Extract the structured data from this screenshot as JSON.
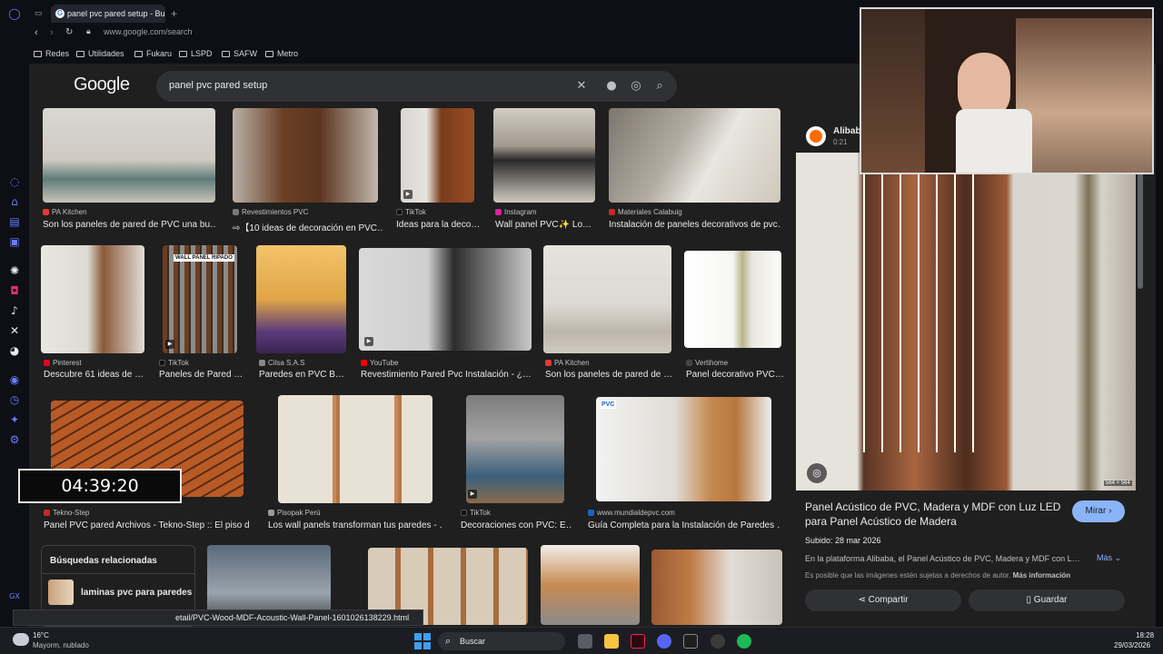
{
  "browser": {
    "tab_title": "panel pvc pared setup - Bu",
    "url": "www.google.com/search",
    "bookmarks": [
      "Redes",
      "Utilidades",
      "Fukaru",
      "LSPD",
      "SAFW",
      "Metro"
    ]
  },
  "search": {
    "logo": "Google",
    "query": "panel pvc pared setup"
  },
  "results": [
    {
      "source": "PA Kitchen",
      "title": "Son los paneles de pared de PVC una bu…",
      "fav": "#e53935"
    },
    {
      "source": "Revestimientos PVC",
      "title": "⇨【10 ideas de decoración en PVC…",
      "fav": "#777777"
    },
    {
      "source": "TikTok",
      "title": "Ideas para la deco…",
      "fav": "#111111"
    },
    {
      "source": "Instagram",
      "title": "Wall panel PVC✨ Lo…",
      "fav": "#d6249f"
    },
    {
      "source": "Materiales Calabuig",
      "title": "Instalación de paneles decorativos de pvc…",
      "fav": "#c62828"
    },
    {
      "source": "Pinterest",
      "title": "Descubre 61 ideas de …",
      "fav": "#e60023"
    },
    {
      "source": "TikTok",
      "title": "Paneles de Pared …",
      "fav": "#111111"
    },
    {
      "source": "Cilsa S.A.S",
      "title": "Paredes en PVC B…",
      "fav": "#888888"
    },
    {
      "source": "YouTube",
      "title": "Revestimiento Pared Pvc Instalación - ¿…",
      "fav": "#ff0000"
    },
    {
      "source": "PA Kitchen",
      "title": "Son los paneles de pared de …",
      "fav": "#e53935"
    },
    {
      "source": "Vertihome",
      "title": "Panel decorativo PVC…",
      "fav": "#444444"
    },
    {
      "source": "Tekno-Step",
      "title": "Panel PVC pared Archivos - Tekno-Step :: El piso d…",
      "fav": "#c62828"
    },
    {
      "source": "Pisopak Perú",
      "title": "Los wall panels transforman tus paredes - …",
      "fav": "#999999"
    },
    {
      "source": "TikTok",
      "title": "Decoraciones con PVC: E…",
      "fav": "#111111"
    },
    {
      "source": "www.mundialdepvc.com",
      "title": "Guía Completa para la Instalación de Paredes …",
      "fav": "#1565c0"
    }
  ],
  "thumb_badge": "WALL PANEL RIPADO",
  "thumb_logo": "PVC",
  "related": {
    "heading": "Búsquedas relacionadas",
    "item": "laminas pvc para paredes"
  },
  "panel": {
    "site": "Alibab",
    "time": "0:21",
    "dims": "564 × 564",
    "title": "Panel Acústico de PVC, Madera y MDF con Luz LED para Panel Acústico de Madera",
    "date": "Subido: 28 mar 2026",
    "desc": "En la plataforma Alibaba, el Panel Acústico de PVC, Madera y MDF con L…",
    "more": "Más",
    "copyright": "Es posible que las imágenes estén sujetas a derechos de autor.",
    "more_info": "Más información",
    "visit": "Mirar",
    "share": "Compartir",
    "save": "Guardar"
  },
  "timer": "04:39:20",
  "status_url": "etail/PVC-Wood-MDF-Acoustic-Wall-Panel-1601026138229.html",
  "taskbar": {
    "temp": "16°C",
    "weather": "Mayorm. nublado",
    "search": "Buscar",
    "time": "18:28",
    "date": "29/03/2026"
  },
  "colors": {
    "accent_blue": "#8ab4f8",
    "page_bg": "#1f1f1f",
    "sidebar_accent": "#6b7cff"
  }
}
